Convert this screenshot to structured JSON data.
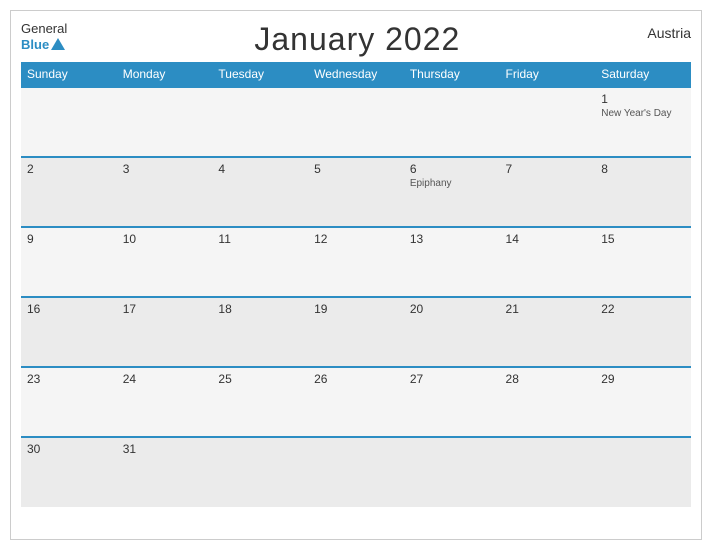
{
  "header": {
    "title": "January 2022",
    "country": "Austria",
    "logo_general": "General",
    "logo_blue": "Blue"
  },
  "weekdays": [
    "Sunday",
    "Monday",
    "Tuesday",
    "Wednesday",
    "Thursday",
    "Friday",
    "Saturday"
  ],
  "weeks": [
    [
      {
        "day": "",
        "event": ""
      },
      {
        "day": "",
        "event": ""
      },
      {
        "day": "",
        "event": ""
      },
      {
        "day": "",
        "event": ""
      },
      {
        "day": "",
        "event": ""
      },
      {
        "day": "",
        "event": ""
      },
      {
        "day": "1",
        "event": "New Year's Day"
      }
    ],
    [
      {
        "day": "2",
        "event": ""
      },
      {
        "day": "3",
        "event": ""
      },
      {
        "day": "4",
        "event": ""
      },
      {
        "day": "5",
        "event": ""
      },
      {
        "day": "6",
        "event": "Epiphany"
      },
      {
        "day": "7",
        "event": ""
      },
      {
        "day": "8",
        "event": ""
      }
    ],
    [
      {
        "day": "9",
        "event": ""
      },
      {
        "day": "10",
        "event": ""
      },
      {
        "day": "11",
        "event": ""
      },
      {
        "day": "12",
        "event": ""
      },
      {
        "day": "13",
        "event": ""
      },
      {
        "day": "14",
        "event": ""
      },
      {
        "day": "15",
        "event": ""
      }
    ],
    [
      {
        "day": "16",
        "event": ""
      },
      {
        "day": "17",
        "event": ""
      },
      {
        "day": "18",
        "event": ""
      },
      {
        "day": "19",
        "event": ""
      },
      {
        "day": "20",
        "event": ""
      },
      {
        "day": "21",
        "event": ""
      },
      {
        "day": "22",
        "event": ""
      }
    ],
    [
      {
        "day": "23",
        "event": ""
      },
      {
        "day": "24",
        "event": ""
      },
      {
        "day": "25",
        "event": ""
      },
      {
        "day": "26",
        "event": ""
      },
      {
        "day": "27",
        "event": ""
      },
      {
        "day": "28",
        "event": ""
      },
      {
        "day": "29",
        "event": ""
      }
    ],
    [
      {
        "day": "30",
        "event": ""
      },
      {
        "day": "31",
        "event": ""
      },
      {
        "day": "",
        "event": ""
      },
      {
        "day": "",
        "event": ""
      },
      {
        "day": "",
        "event": ""
      },
      {
        "day": "",
        "event": ""
      },
      {
        "day": "",
        "event": ""
      }
    ]
  ]
}
